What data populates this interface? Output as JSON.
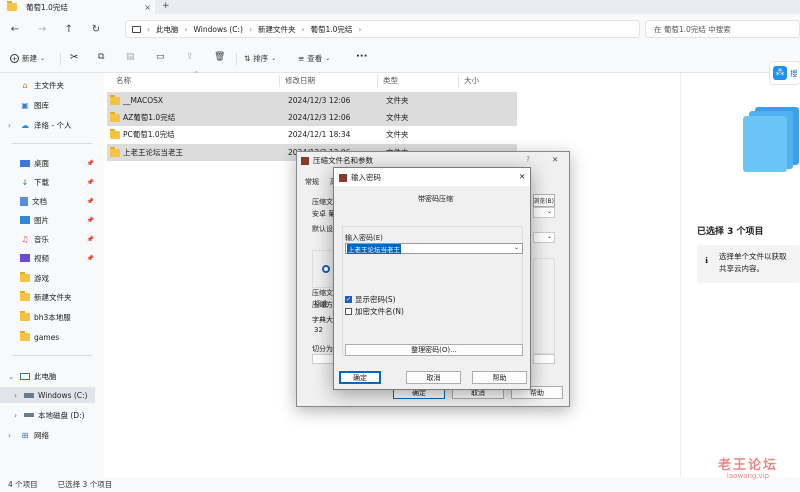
{
  "tab": {
    "title": "葡萄1.0完结",
    "close": "×",
    "new": "+"
  },
  "address": {
    "pc": "此电脑",
    "drive": "Windows (C:)",
    "folder1": "新建文件夹",
    "folder2": "葡萄1.0完结",
    "search_placeholder": "在 葡萄1.0完结 中搜索"
  },
  "toolbar": {
    "new_label": "新建",
    "sort_label": "排序",
    "view_label": "查看",
    "more": "···"
  },
  "sidebar": {
    "top": [
      {
        "label": "主文件夹"
      },
      {
        "label": "图库"
      },
      {
        "label": "泽络 - 个人"
      }
    ],
    "pinned": [
      {
        "label": "桌面"
      },
      {
        "label": "下载"
      },
      {
        "label": "文档"
      },
      {
        "label": "图片"
      },
      {
        "label": "音乐"
      },
      {
        "label": "视频"
      },
      {
        "label": "游戏"
      },
      {
        "label": "新建文件夹"
      },
      {
        "label": "bh3本地服"
      },
      {
        "label": "games"
      }
    ],
    "pc": "此电脑",
    "windows": "Windows (C:)",
    "local": "本地磁盘 (D:)",
    "network": "网络"
  },
  "columns": {
    "name": "名称",
    "date": "修改日期",
    "type": "类型",
    "size": "大小"
  },
  "files": [
    {
      "name": "__MACOSX",
      "date": "2024/12/3 12:06",
      "type": "文件夹"
    },
    {
      "name": "AZ葡萄1.0完结",
      "date": "2024/12/3 12:06",
      "type": "文件夹"
    },
    {
      "name": "PC葡萄1.0完结",
      "date": "2024/12/1 18:34",
      "type": "文件夹"
    },
    {
      "name": "上老王论坛当老王",
      "date": "2024/12/3 12:06",
      "type": "文件夹"
    }
  ],
  "detail": {
    "selected": "已选择 3 个项目",
    "info": "选择单个文件以获取",
    "info2": "共享云内容。",
    "cloud_btn": "搜"
  },
  "status": {
    "count": "4 个项目",
    "selected": "已选择 3 个项目"
  },
  "dialog_archive": {
    "title": "压缩文件名和参数",
    "help": "?",
    "close": "✕",
    "tab_general": "常规",
    "tab_adv": "高",
    "archive_name_label": "压缩文",
    "archive_name_value": "安卓 葡",
    "browse": "浏览(B)...",
    "default_label": "默认设",
    "format_label": "压缩文",
    "method_label": "压缩方",
    "method_value": "标准",
    "dict_label": "字典大",
    "dict_value": "32",
    "split_label": "切分为",
    "ok": "确定",
    "cancel": "取消",
    "help_btn": "帮助"
  },
  "dialog_password": {
    "title": "输入密码",
    "close": "✕",
    "heading": "带密码压缩",
    "input_label": "输入密码(E)",
    "input_value": "上老王论坛当老王",
    "show_pw": "显示密码(S)",
    "encrypt_names": "加密文件名(N)",
    "manage": "整理密码(O)...",
    "ok": "确定",
    "cancel": "取消",
    "help": "帮助"
  },
  "watermark": {
    "line1": "老王论坛",
    "line2": "laowang.vip"
  },
  "colors": {
    "accent": "#0067c0",
    "folder": "#f4c344",
    "watermark": "#e05555"
  }
}
